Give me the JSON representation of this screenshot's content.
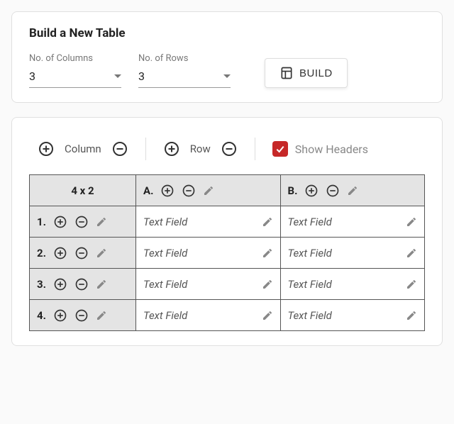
{
  "build_card": {
    "title": "Build a New Table",
    "columns_label": "No. of Columns",
    "columns_value": "3",
    "rows_label": "No. of Rows",
    "rows_value": "3",
    "build_button": "BUILD"
  },
  "toolbar": {
    "column_label": "Column",
    "row_label": "Row",
    "show_headers_label": "Show Headers"
  },
  "table": {
    "corner_label": "4 x 2",
    "col_headers": [
      {
        "label": "A."
      },
      {
        "label": "B."
      }
    ],
    "rows": [
      {
        "label": "1.",
        "cells": [
          "Text Field",
          "Text Field"
        ]
      },
      {
        "label": "2.",
        "cells": [
          "Text Field",
          "Text Field"
        ]
      },
      {
        "label": "3.",
        "cells": [
          "Text Field",
          "Text Field"
        ]
      },
      {
        "label": "4.",
        "cells": [
          "Text Field",
          "Text Field"
        ]
      }
    ]
  }
}
